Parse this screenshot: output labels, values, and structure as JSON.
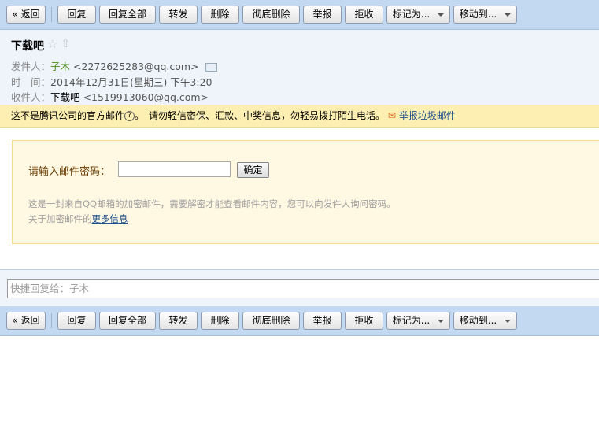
{
  "toolbar": {
    "back": "« 返回",
    "reply": "回复",
    "reply_all": "回复全部",
    "forward": "转发",
    "delete": "删除",
    "delete_permanent": "彻底删除",
    "report": "举报",
    "reject": "拒收",
    "mark_as": "标记为...",
    "move_to": "移动到..."
  },
  "mail": {
    "subject": "下载吧",
    "from_label": "发件人：",
    "from_name": "子木",
    "from_email": "<2272625283@qq.com>",
    "time_label": "时　间：",
    "time": "2014年12月31日(星期三) 下午3:20",
    "to_label": "收件人：",
    "to_name": "下载吧",
    "to_email": "<1519913060@qq.com>"
  },
  "warning": {
    "text1": "这不是腾讯公司的官方邮件",
    "help": "?",
    "text2": "。　请勿轻信密保、汇款、中奖信息，勿轻易拨打陌生电话。",
    "report_spam": "举报垃圾邮件"
  },
  "encrypted": {
    "label": "请输入邮件密码：",
    "password_value": "",
    "confirm": "确定",
    "desc": "这是一封来自QQ邮箱的加密邮件，需要解密才能查看邮件内容，您可以向发件人询问密码。",
    "more_prefix": "关于加密邮件的",
    "more_link": "更多信息"
  },
  "quick_reply": {
    "placeholder": "快捷回复给：子木"
  }
}
